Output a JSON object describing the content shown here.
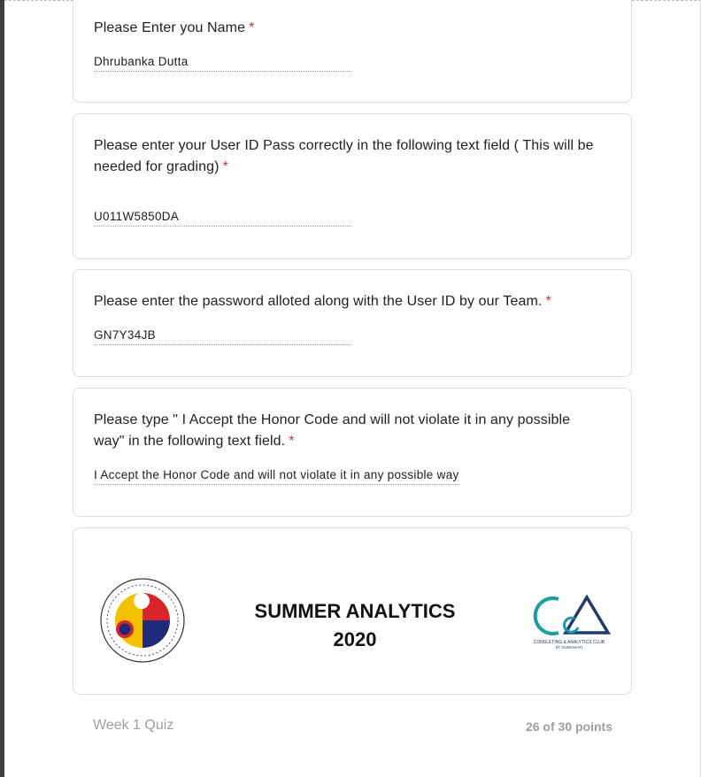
{
  "questions": [
    {
      "label": "Please Enter you Name",
      "required_mark": "*",
      "answer": "Dhrubanka Dutta"
    },
    {
      "label": "Please enter your User ID Pass correctly in the following text field ( This will be needed for grading)",
      "required_mark": "*",
      "answer": "U011W5850DA"
    },
    {
      "label": "Please enter the password alloted along with the User ID by our Team.",
      "required_mark": "*",
      "answer": "GN7Y34JB"
    },
    {
      "label": "Please type \" I Accept the Honor Code and will not violate it in any possible way\" in the following text field.",
      "required_mark": "*",
      "answer": "I Accept the Honor Code and will not violate it in any possible way"
    }
  ],
  "banner": {
    "title_line1": "SUMMER ANALYTICS",
    "title_line2": "2020",
    "left_logo_text": "भारतीय प्रौद्योगिकी संस्थान गुवाहाटी Indian Institute of Technology Guwahati",
    "right_logo_text": "CONSULTING & ANALYTICS CLUB IIT GUWAHATI"
  },
  "footer": {
    "quiz_name": "Week 1 Quiz",
    "score": "26 of 30 points"
  },
  "colors": {
    "required": "#d93025",
    "border": "#dadce0",
    "muted": "#9aa0a6",
    "teal": "#1a9ba8",
    "navy": "#1f3a6e"
  }
}
